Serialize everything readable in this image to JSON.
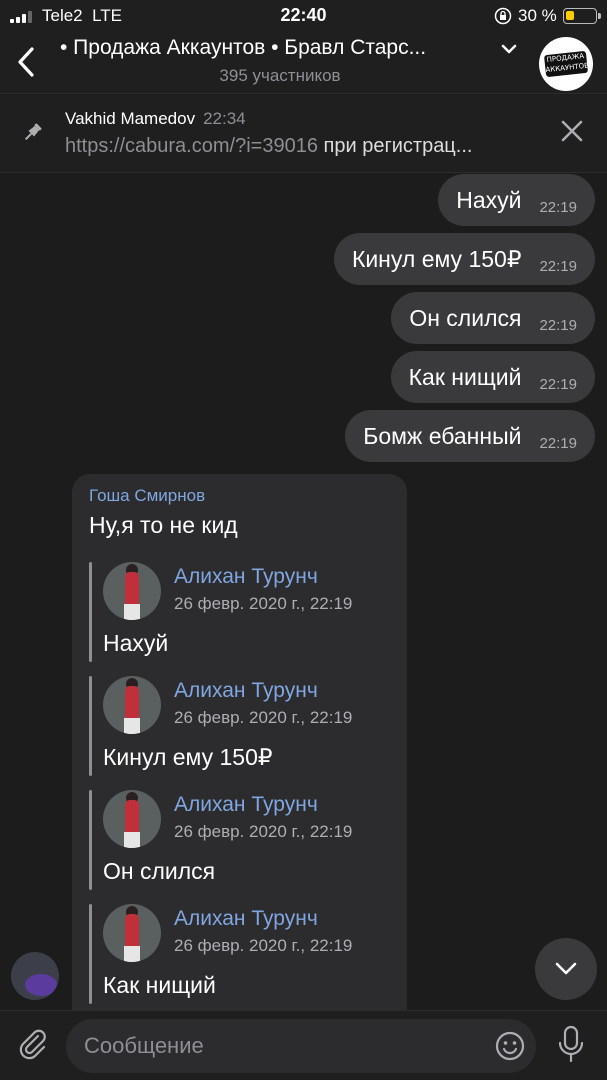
{
  "status_bar": {
    "carrier": "Tele2",
    "network": "LTE",
    "time": "22:40",
    "battery_percent": "30 %",
    "battery_level": 0.3,
    "battery_color": "#ffcc00"
  },
  "header": {
    "title": "• Продажа Аккаунтов • Бравл Старс...",
    "subtitle": "395 участников",
    "channel_avatar_text": "ПРОДАЖА АККАУНТОВ"
  },
  "pinned": {
    "author": "Vakhid Mamedov",
    "time": "22:34",
    "link": "https://cabura.com/?i=39016",
    "text_rest": " при регистрац..."
  },
  "outgoing_messages": [
    {
      "text": "Нахуй",
      "time": "22:19"
    },
    {
      "text": "Кинул ему 150₽",
      "time": "22:19"
    },
    {
      "text": "Он слился",
      "time": "22:19"
    },
    {
      "text": "Как нищий",
      "time": "22:19"
    },
    {
      "text": "Бомж ебанный",
      "time": "22:19"
    }
  ],
  "incoming": {
    "sender": "Гоша Смирнов",
    "text": "Ну,я то не кид",
    "quotes": [
      {
        "name": "Алихан Турунч",
        "date": "26 февр. 2020 г., 22:19",
        "text": "Нахуй"
      },
      {
        "name": "Алихан Турунч",
        "date": "26 февр. 2020 г., 22:19",
        "text": "Кинул ему 150₽"
      },
      {
        "name": "Алихан Турунч",
        "date": "26 февр. 2020 г., 22:19",
        "text": "Он слился"
      },
      {
        "name": "Алихан Турунч",
        "date": "26 февр. 2020 г., 22:19",
        "text": "Как нищий"
      }
    ]
  },
  "input": {
    "placeholder": "Сообщение"
  },
  "icons": {
    "back": "chevron-left-icon",
    "pin": "pin-icon",
    "close": "close-icon",
    "scroll_down": "chevron-down-icon",
    "attach": "paperclip-icon",
    "emoji": "emoji-icon",
    "mic": "microphone-icon"
  },
  "colors": {
    "accent_name": "#7fa6e0",
    "background": "#1c1c1d",
    "bubble": "#3a3a3c"
  }
}
